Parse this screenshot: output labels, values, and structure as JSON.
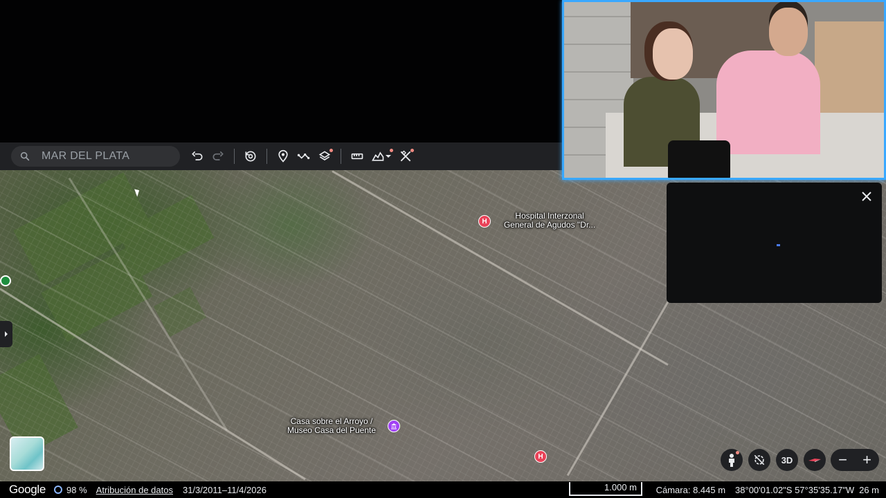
{
  "toolbar": {
    "search_placeholder": "MAR DEL PLATA",
    "icons": [
      "search-icon",
      "undo-icon",
      "redo-icon",
      "history-icon",
      "placemark-icon",
      "path-icon",
      "layers-icon",
      "ruler-icon",
      "elevation-icon",
      "dropdown-icon",
      "tools-icon"
    ]
  },
  "map": {
    "labels": {
      "hospital": "Hospital Interzonal\nGeneral de Agudos \"Dr...",
      "museum": "Casa sobre el Arroyo /\nMuseo Casa del Puente"
    },
    "pin_letter": "H"
  },
  "controls": {
    "btn_3d": "3D",
    "zoom_out": "−",
    "zoom_in": "+"
  },
  "status": {
    "brand": "Google",
    "loading_percent": "98 %",
    "attribution": "Atribución de datos",
    "imagery_dates": "31/3/2011–11/4/2026",
    "scale": "1.000 m",
    "camera": "Cámara: 8.445 m",
    "coords": "38°00'01.02\"S 57°35'35.17\"W",
    "elevation": "26 m"
  },
  "colors": {
    "toolbar_bg": "#202124",
    "webcam_border": "#39a8ff",
    "hospital_pin": "#e94359",
    "museum_pin": "#a142f4",
    "place_pin": "#1e8e3e"
  }
}
